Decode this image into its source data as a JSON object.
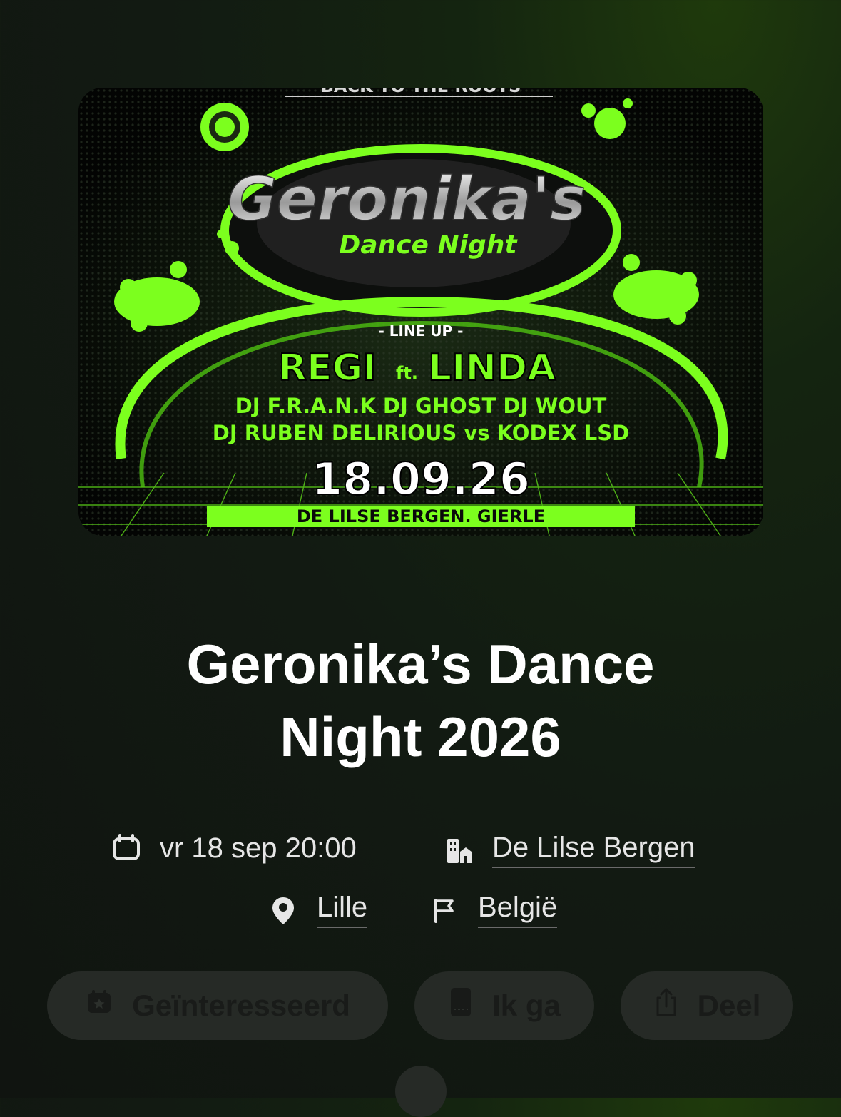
{
  "poster": {
    "top_text": "BACK TO THE ROOTS",
    "logo_main": "Geronika's",
    "logo_sub": "Dance Night",
    "line_up_label": "- LINE UP -",
    "headliner_a": "REGI",
    "headliner_ft": "ft.",
    "headliner_b": "LINDA",
    "lineup_row1": "DJ F.R.A.N.K   DJ GHOST   DJ WOUT",
    "lineup_row2": "DJ RUBEN   DELIRIOUS vs KODEX   LSD",
    "date": "18.09.26",
    "venue": "DE LILSE BERGEN. GIERLE",
    "accent": "#7cff1e"
  },
  "event": {
    "title_line1": "Geronika’s Dance",
    "title_line2": "Night 2026"
  },
  "details": {
    "datetime": "vr 18 sep 20:00",
    "venue": "De Lilse Bergen",
    "city": "Lille",
    "country": "België"
  },
  "actions": {
    "interested": "Geïnteresseerd",
    "going": "Ik ga",
    "share": "Deel"
  },
  "icons": {
    "calendar": "calendar-icon",
    "building": "building-icon",
    "pin": "location-pin-icon",
    "flag": "flag-icon",
    "calendar_star": "calendar-star-icon",
    "ticket": "ticket-icon",
    "share": "share-icon"
  }
}
